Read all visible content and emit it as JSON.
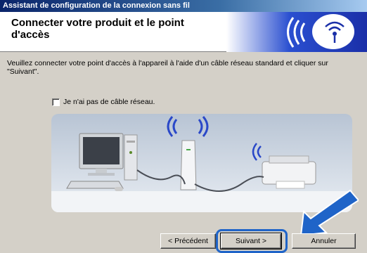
{
  "window": {
    "title": "Assistant de configuration de la connexion sans fil"
  },
  "header": {
    "title": "Connecter votre produit et le point d'accès",
    "graphic_icon": "wireless-signal-icon"
  },
  "main": {
    "instruction": "Veuillez connecter votre point d'accès à l'appareil à l'aide d'un câble réseau standard et cliquer sur \"Suivant\".",
    "checkbox": {
      "label": "Je n'ai pas de câble réseau.",
      "checked": false
    },
    "illustration_icon": "network-connection-illustration"
  },
  "buttons": {
    "previous_label": "< Précédent",
    "next_label": "Suivant >",
    "cancel_label": "Annuler"
  },
  "colors": {
    "titlebar": "#0a246a",
    "dialog_background": "#d4d0c8",
    "highlight": "#1f64c8",
    "pointer_arrow": "#1f64c8"
  }
}
